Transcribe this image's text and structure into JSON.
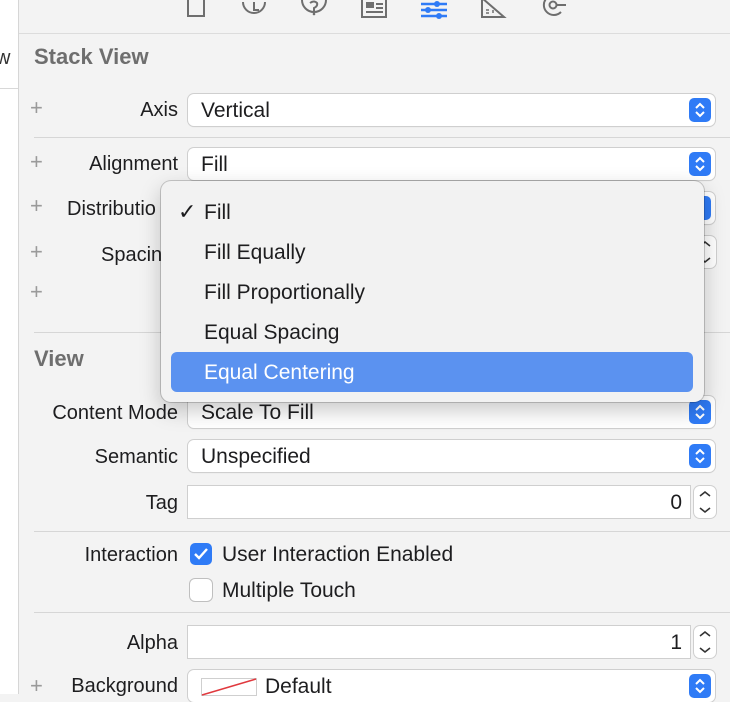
{
  "left_pane": {
    "fragment": "w"
  },
  "toolbar": {
    "icons": [
      "file-icon",
      "history-icon",
      "help-icon",
      "identity-icon",
      "attributes-icon",
      "size-icon",
      "connections-icon"
    ],
    "accent": "#2f7bf6"
  },
  "stack_view": {
    "title": "Stack View",
    "axis": {
      "label": "Axis",
      "value": "Vertical"
    },
    "alignment": {
      "label": "Alignment",
      "value": "Fill"
    },
    "distribution": {
      "label": "Distributio"
    },
    "spacing": {
      "label": "Spacin"
    }
  },
  "view": {
    "title": "View",
    "content_mode": {
      "label": "Content Mode",
      "value": "Scale To Fill"
    },
    "semantic": {
      "label": "Semantic",
      "value": "Unspecified"
    },
    "tag": {
      "label": "Tag",
      "value": "0"
    },
    "interaction": {
      "label": "Interaction",
      "user_interaction": {
        "label": "User Interaction Enabled",
        "checked": true
      },
      "multiple_touch": {
        "label": "Multiple Touch",
        "checked": false
      }
    },
    "alpha": {
      "label": "Alpha",
      "value": "1"
    },
    "background": {
      "label": "Background",
      "value": "Default"
    }
  },
  "dropdown": {
    "items": [
      {
        "label": "Fill",
        "checked": true
      },
      {
        "label": "Fill Equally"
      },
      {
        "label": "Fill Proportionally"
      },
      {
        "label": "Equal Spacing"
      },
      {
        "label": "Equal Centering",
        "highlighted": true
      }
    ],
    "check_glyph": "✓",
    "highlight_color": "#5b92f0"
  }
}
